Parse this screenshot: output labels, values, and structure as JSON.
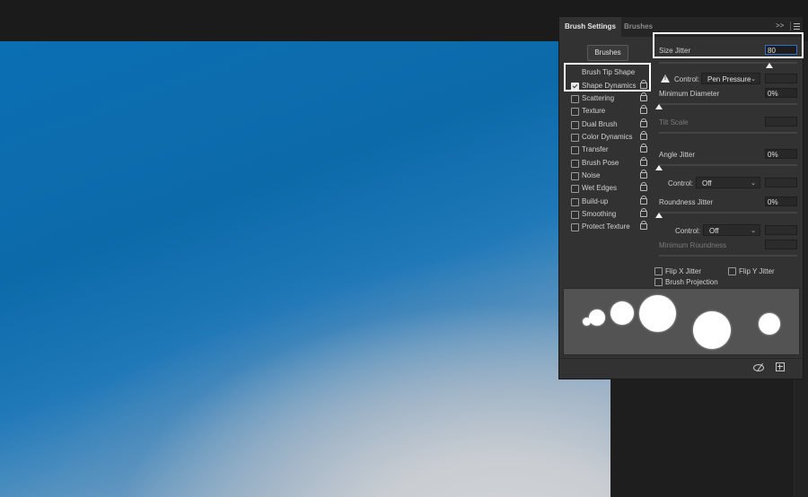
{
  "panel": {
    "tabs": [
      {
        "label": "Brush Settings"
      },
      {
        "label": "Brushes"
      }
    ],
    "collapse_glyph": ">>",
    "brushes_button": "Brushes"
  },
  "left_list": {
    "header": "Brush Tip Shape",
    "items": [
      {
        "label": "Shape Dynamics",
        "checked": true
      },
      {
        "label": "Scattering",
        "checked": false
      },
      {
        "label": "Texture",
        "checked": false
      },
      {
        "label": "Dual Brush",
        "checked": false
      },
      {
        "label": "Color Dynamics",
        "checked": false
      },
      {
        "label": "Transfer",
        "checked": false
      },
      {
        "label": "Brush Pose",
        "checked": false
      },
      {
        "label": "Noise",
        "checked": false
      },
      {
        "label": "Wet Edges",
        "checked": false
      },
      {
        "label": "Build-up",
        "checked": false
      },
      {
        "label": "Smoothing",
        "checked": false
      },
      {
        "label": "Protect Texture",
        "checked": false
      }
    ]
  },
  "settings": {
    "size_jitter": {
      "label": "Size Jitter",
      "value": "80"
    },
    "size_control": {
      "label": "Control:",
      "value": "Pen Pressure"
    },
    "min_diameter": {
      "label": "Minimum Diameter",
      "value": "0%"
    },
    "tilt_scale": {
      "label": "Tilt Scale"
    },
    "angle_jitter": {
      "label": "Angle Jitter",
      "value": "0%"
    },
    "angle_control": {
      "label": "Control:",
      "value": "Off"
    },
    "roundness_jitter": {
      "label": "Roundness Jitter",
      "value": "0%"
    },
    "roundness_control": {
      "label": "Control:",
      "value": "Off"
    },
    "min_roundness": {
      "label": "Minimum Roundness"
    },
    "flip_x": {
      "label": "Flip X Jitter",
      "checked": false
    },
    "flip_y": {
      "label": "Flip Y Jitter",
      "checked": false
    },
    "projection": {
      "label": "Brush Projection",
      "checked": false
    }
  },
  "sliders": {
    "size_jitter": 0.8,
    "min_diameter": 0.0,
    "angle_jitter": 0.0,
    "roundness_jitter": 0.0
  },
  "colors": {
    "panel_bg": "#323232",
    "accent": "#2e72c5",
    "highlight": "#ffffff"
  },
  "icons": [
    "warning-icon",
    "lock-icon",
    "chevron-down-icon",
    "eye-icon",
    "new-brush-icon",
    "panel-menu-icon"
  ]
}
